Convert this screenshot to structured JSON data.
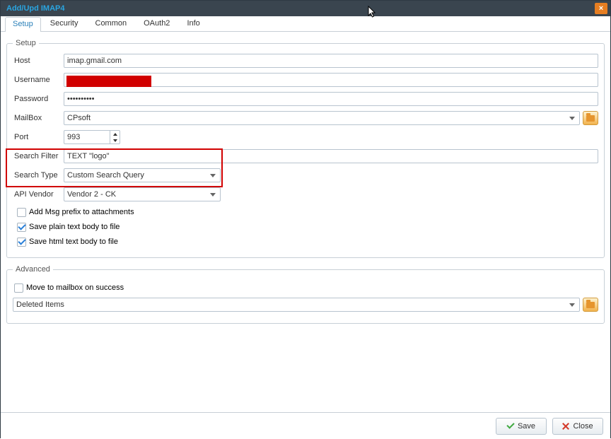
{
  "window": {
    "title": "Add/Upd IMAP4",
    "close_label": "×"
  },
  "tabs": {
    "setup": "Setup",
    "security": "Security",
    "common": "Common",
    "oauth2": "OAuth2",
    "info": "Info"
  },
  "setup": {
    "legend": "Setup",
    "host_label": "Host",
    "host_value": "imap.gmail.com",
    "username_label": "Username",
    "password_label": "Password",
    "password_value": "••••••••••",
    "mailbox_label": "MailBox",
    "mailbox_value": "CPsoft",
    "port_label": "Port",
    "port_value": "993",
    "search_filter_label": "Search Filter",
    "search_filter_value": "TEXT \"logo\"",
    "search_type_label": "Search Type",
    "search_type_value": "Custom Search Query",
    "api_vendor_label": "API Vendor",
    "api_vendor_value": "Vendor 2 - CK",
    "chk_add_prefix": "Add Msg prefix to attachments",
    "chk_save_plain": "Save plain text body to file",
    "chk_save_html": "Save html text body to file"
  },
  "advanced": {
    "legend": "Advanced",
    "chk_move": "Move to mailbox on success",
    "folder_value": "Deleted Items"
  },
  "footer": {
    "save": "Save",
    "close": "Close"
  }
}
